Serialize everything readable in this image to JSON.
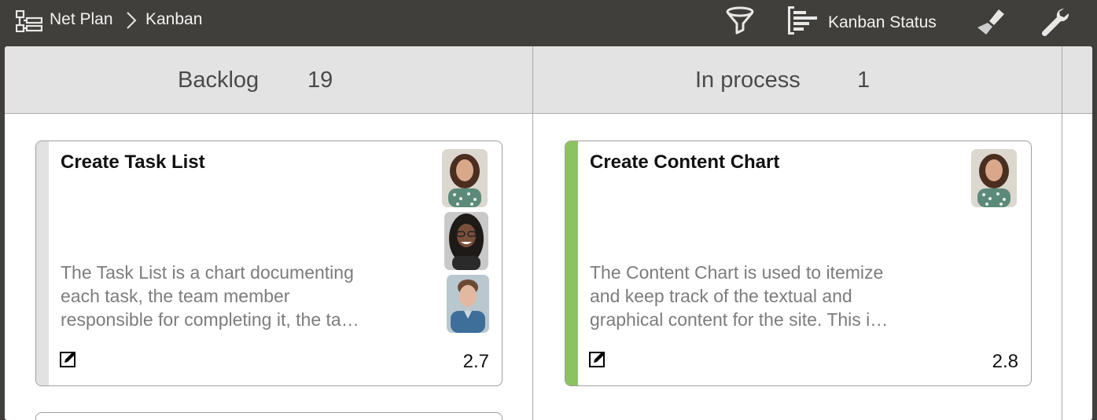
{
  "breadcrumb": {
    "root": "Net Plan",
    "current": "Kanban"
  },
  "toolbar": {
    "view_label": "Kanban Status",
    "icons": [
      "hierarchy-icon",
      "filter-icon",
      "gantt-icon",
      "brush-icon",
      "wrench-icon"
    ]
  },
  "columns": [
    {
      "title": "Backlog",
      "count": "19",
      "cards": [
        {
          "title": "Create Task List",
          "description_lines": [
            "The Task List is a chart documenting",
            "each task, the team member",
            "responsible for completing it, the ta…"
          ],
          "estimate": "2.7",
          "stripe_color": "#e2e2e2",
          "assignees": [
            "avatar-woman-curly-hair",
            "avatar-woman-glasses",
            "avatar-man-denim"
          ]
        }
      ]
    },
    {
      "title": "In process",
      "count": "1",
      "cards": [
        {
          "title": "Create Content Chart",
          "description_lines": [
            "The Content Chart is used to itemize",
            "and keep track of the textual and",
            "graphical content for the site. This i…"
          ],
          "estimate": "2.8",
          "stripe_color": "#8cc260",
          "assignees": [
            "avatar-woman-curly-hair"
          ]
        }
      ]
    }
  ],
  "colors": {
    "topbar": "#403f3b",
    "header": "#e3e3e3",
    "progress": "#8cc260"
  }
}
